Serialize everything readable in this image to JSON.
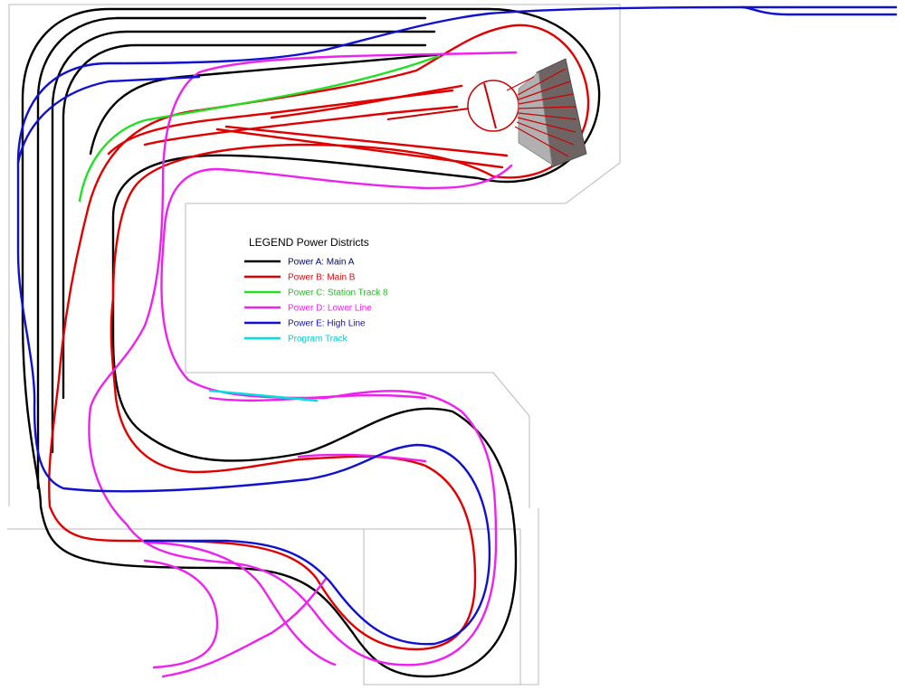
{
  "legend": {
    "title": "LEGEND Power Districts",
    "items": [
      {
        "key": "A",
        "label": "Power A: Main A",
        "line_color": "#000000",
        "text_color": "#000080"
      },
      {
        "key": "B",
        "label": "Power B: Main B",
        "line_color": "#e00000",
        "text_color": "#d01010"
      },
      {
        "key": "C",
        "label": "Power C: Station Track 8",
        "line_color": "#22e022",
        "text_color": "#22c022"
      },
      {
        "key": "D",
        "label": "Power D: Lower Line",
        "line_color": "#ee22ee",
        "text_color": "#ee22ee"
      },
      {
        "key": "E",
        "label": "Power E: High Line",
        "line_color": "#1010d0",
        "text_color": "#1010c0"
      },
      {
        "key": "P",
        "label": "Program Track",
        "line_color": "#00dede",
        "text_color": "#00cccc"
      }
    ]
  },
  "colors": {
    "benchwork": "#b8b8b8",
    "turntable": "#cc0000",
    "roundhouse_dark": "#6e6464",
    "roundhouse_light": "#b0b0b0"
  }
}
